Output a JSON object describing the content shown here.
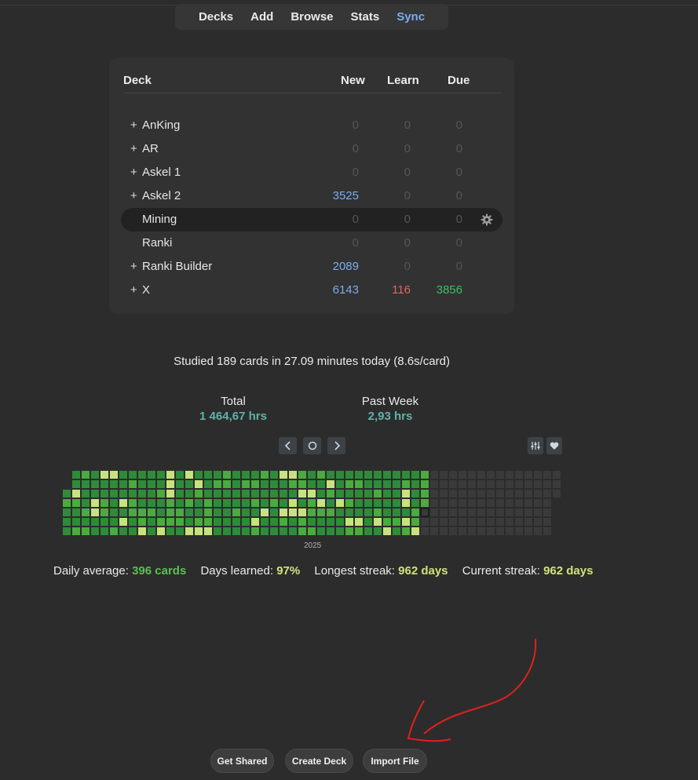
{
  "toolbar": {
    "items": [
      "Decks",
      "Add",
      "Browse",
      "Stats",
      "Sync"
    ],
    "active": "Sync",
    "active_color": "#7cacf0"
  },
  "deck_table": {
    "headers": {
      "deck": "Deck",
      "new": "New",
      "learn": "Learn",
      "due": "Due"
    },
    "rows": [
      {
        "expander": "+",
        "name": "AnKing",
        "new": "0",
        "learn": "0",
        "due": "0"
      },
      {
        "expander": "+",
        "name": "AR",
        "new": "0",
        "learn": "0",
        "due": "0"
      },
      {
        "expander": "+",
        "name": "Askel 1",
        "new": "0",
        "learn": "0",
        "due": "0"
      },
      {
        "expander": "+",
        "name": "Askel 2",
        "new": "3525",
        "learn": "0",
        "due": "0"
      },
      {
        "expander": "",
        "name": "Mining",
        "new": "0",
        "learn": "0",
        "due": "0",
        "current": true
      },
      {
        "expander": "",
        "name": "Ranki",
        "new": "0",
        "learn": "0",
        "due": "0"
      },
      {
        "expander": "+",
        "name": "Ranki Builder",
        "new": "2089",
        "learn": "0",
        "due": "0"
      },
      {
        "expander": "+",
        "name": "X",
        "new": "6143",
        "learn": "116",
        "due": "3856"
      }
    ],
    "colors": {
      "new": "#7cacf0",
      "learn": "#e06464",
      "due": "#3fbf5f",
      "zero": "#555555"
    }
  },
  "studied_text": "Studied 189 cards in 27.09 minutes today (8.6s/card)",
  "time_stats": {
    "total_label": "Total",
    "total_value": "1 464,67 hrs",
    "week_label": "Past Week",
    "week_value": "2,93 hrs"
  },
  "heatmap": {
    "nav_icons": [
      "chevron-left-icon",
      "circle-icon",
      "chevron-right-icon"
    ],
    "right_icons": [
      "sliders-icon",
      "heart-icon"
    ],
    "year_label": "2025",
    "colors": {
      "dark": "#2e8b3a",
      "mid": "#4aab3e",
      "light": "#c8e27d",
      "empty": "#3a3a3a"
    }
  },
  "streaks": {
    "daily_average_label": "Daily average:",
    "daily_average_value": "396 cards",
    "days_learned_label": "Days learned:",
    "days_learned_value": "97%",
    "longest_label": "Longest streak:",
    "longest_value": "962 days",
    "current_label": "Current streak:",
    "current_value": "962 days"
  },
  "bottom_buttons": [
    "Get Shared",
    "Create Deck",
    "Import File"
  ]
}
